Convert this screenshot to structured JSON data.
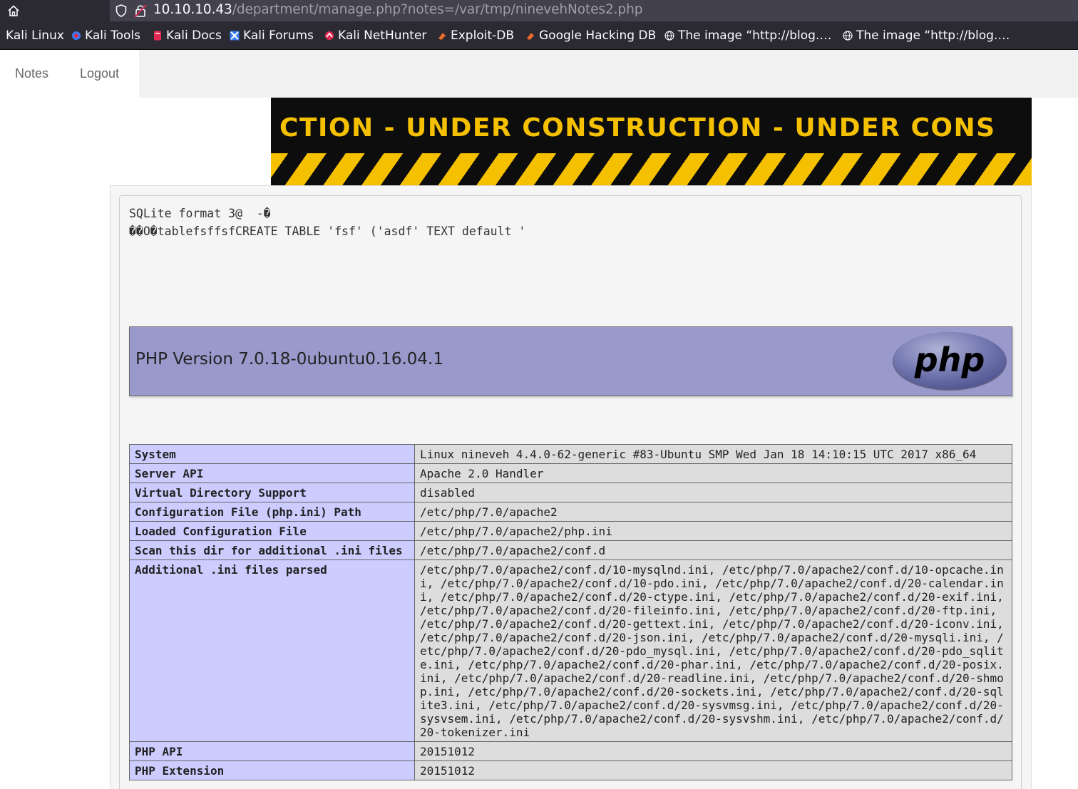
{
  "browser": {
    "url_host": "10.10.10.43",
    "url_path": "/department/manage.php?notes=/var/tmp/ninevehNotes2.php",
    "bookmarks": [
      {
        "label": "Kali Linux",
        "icon": "kali-dragon-icon"
      },
      {
        "label": "Kali Tools",
        "icon": "kali-tools-icon"
      },
      {
        "label": "Kali Docs",
        "icon": "kali-docs-icon"
      },
      {
        "label": "Kali Forums",
        "icon": "kali-forums-icon"
      },
      {
        "label": "Kali NetHunter",
        "icon": "kali-nethunter-icon"
      },
      {
        "label": "Exploit-DB",
        "icon": "exploit-db-icon"
      },
      {
        "label": "Google Hacking DB",
        "icon": "ghdb-icon"
      },
      {
        "label": "The image “http://blog.…",
        "icon": "globe-icon"
      },
      {
        "label": "The image “http://blog.…",
        "icon": "globe-icon"
      }
    ]
  },
  "nav": {
    "notes_label": "Notes",
    "logout_label": "Logout"
  },
  "banner": {
    "text": "CTION - UNDER  CONSTRUCTION - UNDER  CONS",
    "colors": {
      "stripe": "#f5c000",
      "background": "#0d0d0d"
    }
  },
  "sqlite": {
    "line1": "SQLite format 3@  -�",
    "line2": "��O�tablefsffsfCREATE TABLE 'fsf' ('asdf' TEXT default '"
  },
  "phpinfo": {
    "version_title": "PHP Version 7.0.18-0ubuntu0.16.04.1",
    "logo_text": "php",
    "rows": [
      {
        "key": "System",
        "value": "Linux nineveh 4.4.0-62-generic #83-Ubuntu SMP Wed Jan 18 14:10:15 UTC 2017 x86_64"
      },
      {
        "key": "Server API",
        "value": "Apache 2.0 Handler"
      },
      {
        "key": "Virtual Directory Support",
        "value": "disabled"
      },
      {
        "key": "Configuration File (php.ini) Path",
        "value": "/etc/php/7.0/apache2"
      },
      {
        "key": "Loaded Configuration File",
        "value": "/etc/php/7.0/apache2/php.ini"
      },
      {
        "key": "Scan this dir for additional .ini files",
        "value": "/etc/php/7.0/apache2/conf.d"
      },
      {
        "key": "Additional .ini files parsed",
        "value": "/etc/php/7.0/apache2/conf.d/10-mysqlnd.ini, /etc/php/7.0/apache2/conf.d/10-opcache.ini, /etc/php/7.0/apache2/conf.d/10-pdo.ini, /etc/php/7.0/apache2/conf.d/20-calendar.ini, /etc/php/7.0/apache2/conf.d/20-ctype.ini, /etc/php/7.0/apache2/conf.d/20-exif.ini, /etc/php/7.0/apache2/conf.d/20-fileinfo.ini, /etc/php/7.0/apache2/conf.d/20-ftp.ini, /etc/php/7.0/apache2/conf.d/20-gettext.ini, /etc/php/7.0/apache2/conf.d/20-iconv.ini, /etc/php/7.0/apache2/conf.d/20-json.ini, /etc/php/7.0/apache2/conf.d/20-mysqli.ini, /etc/php/7.0/apache2/conf.d/20-pdo_mysql.ini, /etc/php/7.0/apache2/conf.d/20-pdo_sqlite.ini, /etc/php/7.0/apache2/conf.d/20-phar.ini, /etc/php/7.0/apache2/conf.d/20-posix.ini, /etc/php/7.0/apache2/conf.d/20-readline.ini, /etc/php/7.0/apache2/conf.d/20-shmop.ini, /etc/php/7.0/apache2/conf.d/20-sockets.ini, /etc/php/7.0/apache2/conf.d/20-sqlite3.ini, /etc/php/7.0/apache2/conf.d/20-sysvmsg.ini, /etc/php/7.0/apache2/conf.d/20-sysvsem.ini, /etc/php/7.0/apache2/conf.d/20-sysvshm.ini, /etc/php/7.0/apache2/conf.d/20-tokenizer.ini"
      },
      {
        "key": "PHP API",
        "value": "20151012"
      },
      {
        "key": "PHP Extension",
        "value": "20151012"
      }
    ]
  },
  "colors": {
    "php_header_bg": "#9999cc",
    "key_cell_bg": "#ccccff",
    "value_cell_bg": "#dddddd"
  }
}
